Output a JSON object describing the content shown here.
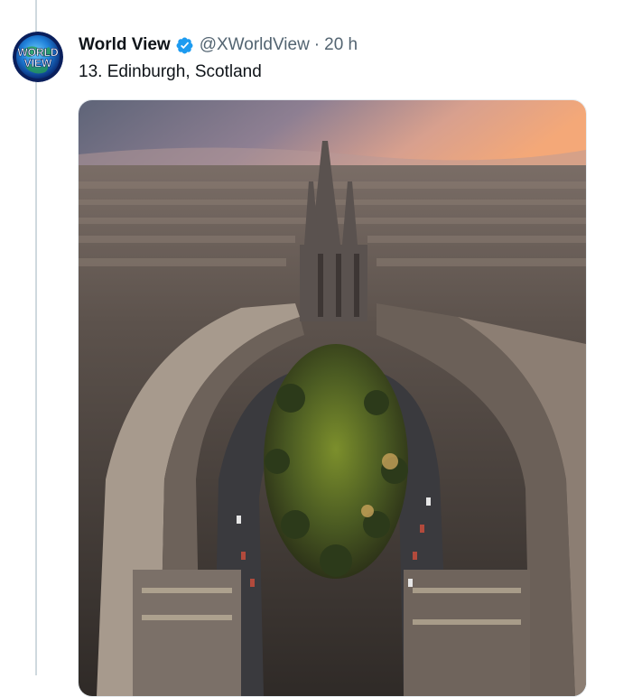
{
  "tweet": {
    "display_name": "World View",
    "handle": "@XWorldView",
    "separator": "·",
    "timestamp": "20 h",
    "text": "13. Edinburgh, Scotland",
    "verified": true,
    "avatar_text": [
      "WORLD",
      "VIEW"
    ]
  },
  "media": {
    "subject": "Aerial view of Edinburgh with cathedral and crescent street"
  },
  "colors": {
    "verified_blue": "#1d9bf0",
    "secondary_text": "#536471",
    "thread_line": "#cfd9de"
  }
}
